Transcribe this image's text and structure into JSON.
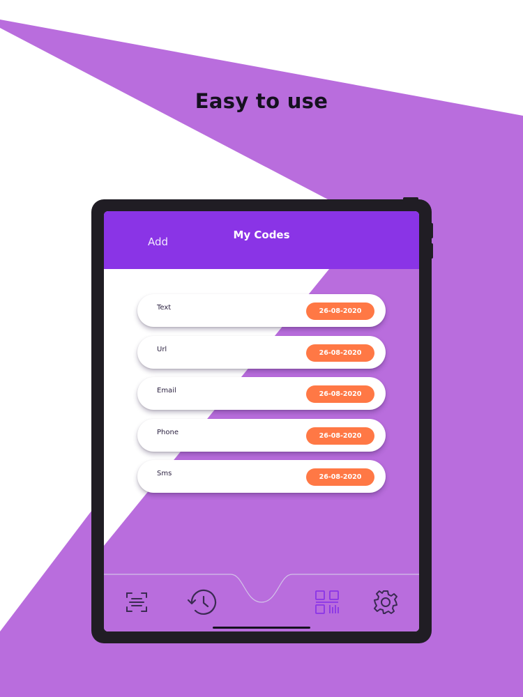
{
  "promo": {
    "headline": "Easy to use"
  },
  "app": {
    "nav": {
      "add_label": "Add",
      "title": "My Codes"
    },
    "codes": [
      {
        "type": "Text",
        "date": "26-08-2020"
      },
      {
        "type": "Url",
        "date": "26-08-2020"
      },
      {
        "type": "Email",
        "date": "26-08-2020"
      },
      {
        "type": "Phone",
        "date": "26-08-2020"
      },
      {
        "type": "Sms",
        "date": "26-08-2020"
      }
    ],
    "tabs": [
      {
        "icon": "scan-icon",
        "active": false
      },
      {
        "icon": "history-icon",
        "active": false
      },
      {
        "icon": "qr-code-icon",
        "active": true
      },
      {
        "icon": "settings-icon",
        "active": false
      }
    ]
  },
  "colors": {
    "brand_purple": "#8a34e6",
    "background_purple": "#b96ddd",
    "date_pill": "#ff7845",
    "icon_dark": "#3a2a52",
    "icon_active": "#8a34e6"
  }
}
